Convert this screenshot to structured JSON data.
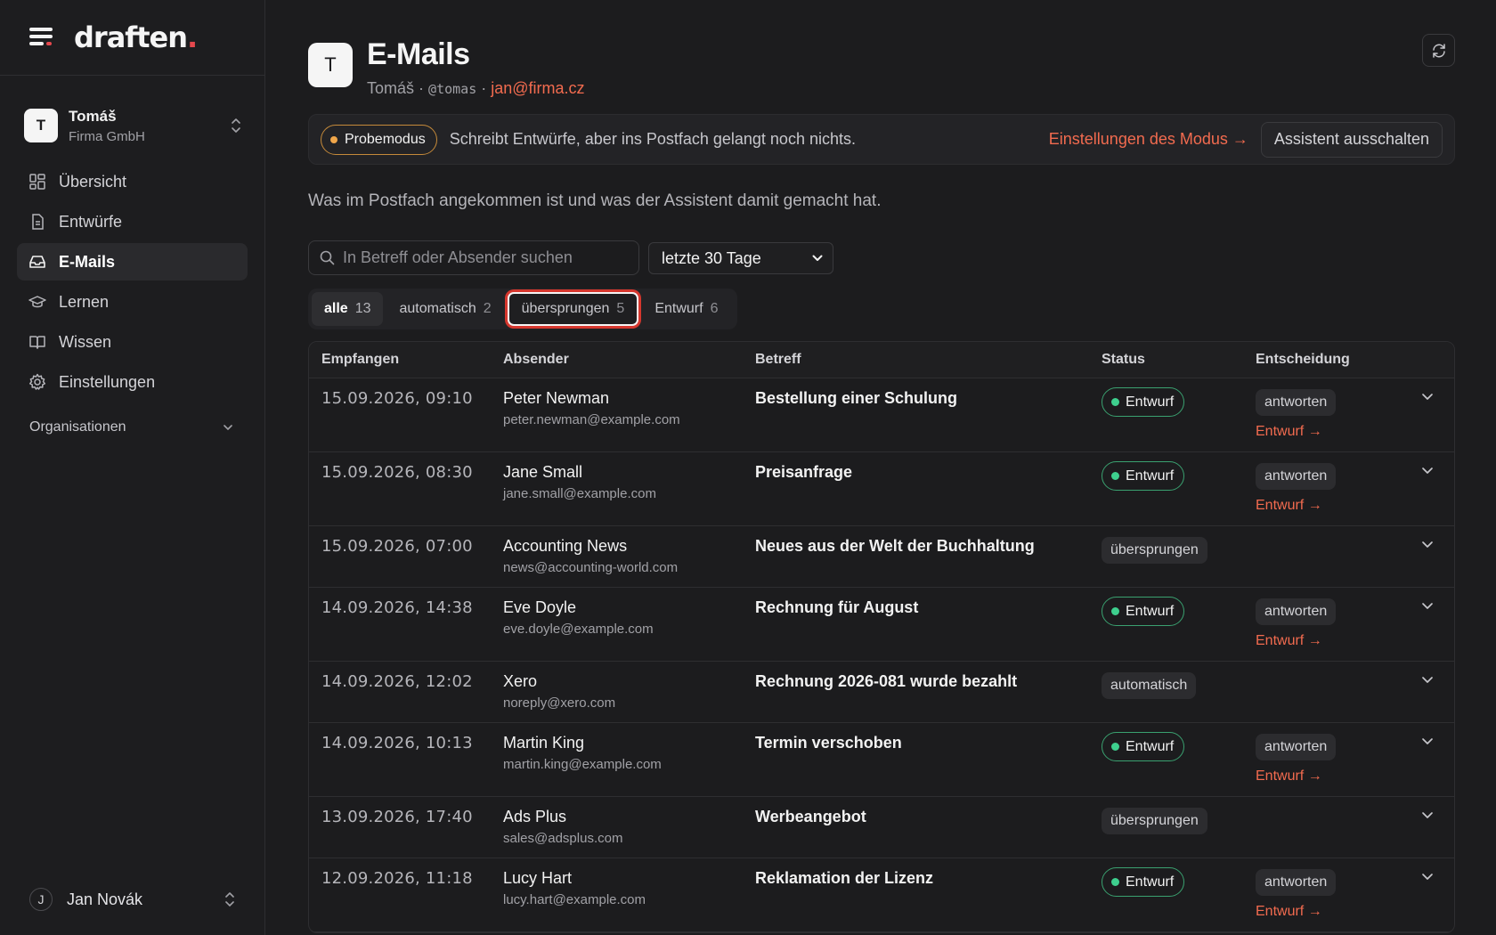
{
  "app": {
    "logo": "draften",
    "logo_dot": "."
  },
  "org": {
    "initial": "T",
    "name": "Tomáš",
    "company": "Firma GmbH"
  },
  "nav": {
    "items": [
      {
        "label": "Übersicht"
      },
      {
        "label": "Entwürfe"
      },
      {
        "label": "E-Mails"
      },
      {
        "label": "Lernen"
      },
      {
        "label": "Wissen"
      },
      {
        "label": "Einstellungen"
      }
    ],
    "section": "Organisationen"
  },
  "user": {
    "initial": "J",
    "name": "Jan Novák"
  },
  "page": {
    "avatar": "T",
    "title": "E-Mails",
    "sub_name": "Tomáš",
    "sub_sep": "·",
    "sub_handle": "@tomas",
    "sub_email": "jan@firma.cz",
    "description": "Was im Postfach angekommen ist und was der Assistent damit gemacht hat."
  },
  "mode": {
    "pill": "Probemodus",
    "text": "Schreibt Entwürfe, aber ins Postfach gelangt noch nichts.",
    "link": "Einstellungen des Modus →",
    "button": "Assistent ausschalten"
  },
  "search": {
    "placeholder": "In Betreff oder Absender suchen"
  },
  "period": {
    "selected": "letzte 30 Tage"
  },
  "tabs": [
    {
      "label": "alle",
      "count": "13"
    },
    {
      "label": "automatisch",
      "count": "2"
    },
    {
      "label": "übersprungen",
      "count": "5"
    },
    {
      "label": "Entwurf",
      "count": "6"
    }
  ],
  "table": {
    "headers": {
      "received": "Empfangen",
      "sender": "Absender",
      "subject": "Betreff",
      "status": "Status",
      "decision": "Entscheidung"
    },
    "rows": [
      {
        "date": "15.09.2026, 09:10",
        "name": "Peter Newman",
        "email": "peter.newman@example.com",
        "subject": "Bestellung einer Schulung",
        "status": "Entwurf",
        "decision": "antworten",
        "link": "Entwurf →"
      },
      {
        "date": "15.09.2026, 08:30",
        "name": "Jane Small",
        "email": "jane.small@example.com",
        "subject": "Preisanfrage",
        "status": "Entwurf",
        "decision": "antworten",
        "link": "Entwurf →"
      },
      {
        "date": "15.09.2026, 07:00",
        "name": "Accounting News",
        "email": "news@accounting-world.com",
        "subject": "Neues aus der Welt der Buchhaltung",
        "status": "übersprungen"
      },
      {
        "date": "14.09.2026, 14:38",
        "name": "Eve Doyle",
        "email": "eve.doyle@example.com",
        "subject": "Rechnung für August",
        "status": "Entwurf",
        "decision": "antworten",
        "link": "Entwurf →"
      },
      {
        "date": "14.09.2026, 12:02",
        "name": "Xero",
        "email": "noreply@xero.com",
        "subject": "Rechnung 2026-081 wurde bezahlt",
        "status": "automatisch"
      },
      {
        "date": "14.09.2026, 10:13",
        "name": "Martin King",
        "email": "martin.king@example.com",
        "subject": "Termin verschoben",
        "status": "Entwurf",
        "decision": "antworten",
        "link": "Entwurf →"
      },
      {
        "date": "13.09.2026, 17:40",
        "name": "Ads Plus",
        "email": "sales@adsplus.com",
        "subject": "Werbeangebot",
        "status": "übersprungen"
      },
      {
        "date": "12.09.2026, 11:18",
        "name": "Lucy Hart",
        "email": "lucy.hart@example.com",
        "subject": "Reklamation der Lizenz",
        "status": "Entwurf",
        "decision": "antworten",
        "link": "Entwurf →"
      }
    ]
  },
  "colors": {
    "accent": "#f26b4f",
    "brand_dot": "#e5484d",
    "draft_green": "#3ecf8e",
    "trial_orange": "#f0a64a",
    "background": "#1c1c1e"
  }
}
